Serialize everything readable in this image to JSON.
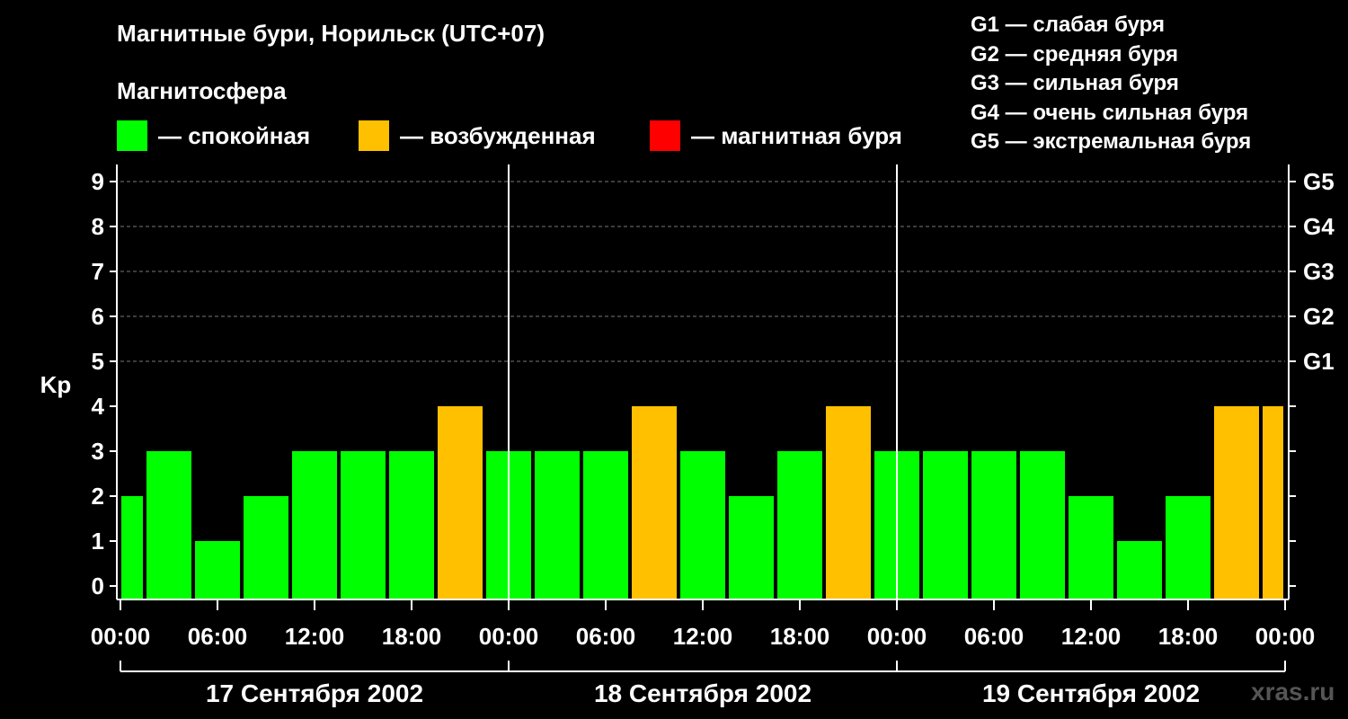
{
  "title": "Магнитные бури, Норильск (UTC+07)",
  "subtitle": "Магнитосфера",
  "legend": [
    {
      "label": "— спокойная",
      "color": "#00ff00"
    },
    {
      "label": "— возбужденная",
      "color": "#ffc000"
    },
    {
      "label": "— магнитная буря",
      "color": "#ff0000"
    }
  ],
  "g_levels": [
    "G1 — слабая буря",
    "G2 — средняя буря",
    "G3 — сильная буря",
    "G4 — очень сильная буря",
    "G5 — экстремальная буря"
  ],
  "watermark": "xras.ru",
  "chart_data": {
    "type": "bar",
    "ylabel": "Kp",
    "ylim": [
      0,
      9
    ],
    "y_ticks": [
      "0",
      "1",
      "2",
      "3",
      "4",
      "5",
      "6",
      "7",
      "8",
      "9"
    ],
    "right_ticks": [
      {
        "value": 5,
        "label": "G1"
      },
      {
        "value": 6,
        "label": "G2"
      },
      {
        "value": 7,
        "label": "G3"
      },
      {
        "value": 8,
        "label": "G4"
      },
      {
        "value": 9,
        "label": "G5"
      }
    ],
    "x_tick_labels": [
      "00:00",
      "06:00",
      "12:00",
      "18:00",
      "00:00",
      "06:00",
      "12:00",
      "18:00",
      "00:00",
      "06:00",
      "12:00",
      "18:00",
      "00:00"
    ],
    "days": [
      "17 Сентября 2002",
      "18 Сентября 2002",
      "19 Сентября 2002"
    ],
    "values": [
      2,
      3,
      1,
      2,
      3,
      3,
      3,
      4,
      3,
      3,
      3,
      4,
      3,
      2,
      3,
      4,
      3,
      3,
      3,
      3,
      2,
      1,
      2,
      4,
      4
    ],
    "colors": {
      "quiet": "#00ff00",
      "active": "#ffc000",
      "storm": "#ff0000"
    },
    "grid": true
  }
}
